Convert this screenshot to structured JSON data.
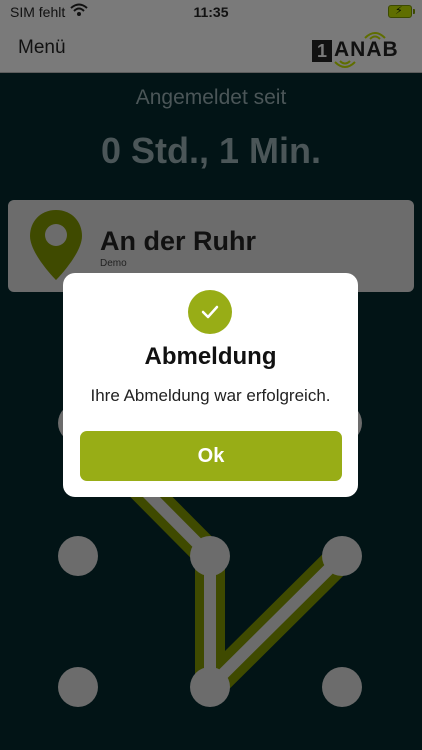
{
  "status_bar": {
    "carrier": "SIM fehlt",
    "time": "11:35",
    "wifi_icon": "wifi-icon",
    "battery_icon": "battery-charging-icon"
  },
  "nav": {
    "menu_label": "Menü",
    "logo_text": "ANAB",
    "logo_number": "1"
  },
  "session": {
    "since_label": "Angemeldet seit",
    "duration": "0 Std., 1 Min."
  },
  "location": {
    "name": "An der Ruhr",
    "subtitle": "Demo",
    "icon": "location-pin-icon"
  },
  "dialog": {
    "icon": "checkmark-icon",
    "title": "Abmeldung",
    "message": "Ihre Abmeldung war erfolgreich.",
    "ok_label": "Ok"
  },
  "colors": {
    "accent": "#98ad16",
    "background": "#021416",
    "overlay_bar": "#7a7a7a",
    "dialog_bg": "#ffffff"
  }
}
